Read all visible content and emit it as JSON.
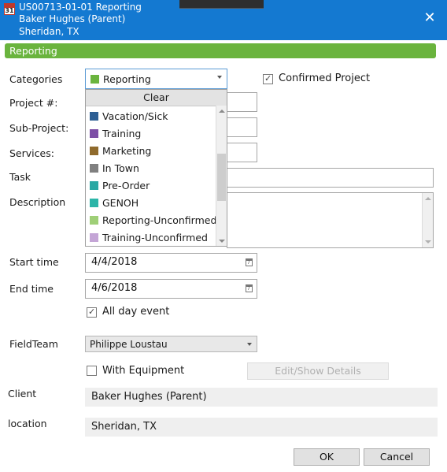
{
  "window": {
    "title_line1": "US00713-01-01 Reporting",
    "title_line2": "Baker Hughes (Parent)",
    "title_line3": "Sheridan, TX",
    "app_icon_text": "31",
    "close_glyph": "✕"
  },
  "banner": {
    "text": "Reporting",
    "color": "#6ab43e"
  },
  "form": {
    "categories_label": "Categories",
    "categories_value": "Reporting",
    "categories_color": "#6ab43e",
    "confirmed_label": "Confirmed Project",
    "confirmed_checked": true,
    "project_label": "Project #:",
    "subproject_label": "Sub-Project:",
    "services_label": "Services:",
    "task_label": "Task",
    "description_label": "Description",
    "start_label": "Start time",
    "start_value": "4/4/2018",
    "end_label": "End time",
    "end_value": "4/6/2018",
    "allday_label": "All day event",
    "allday_checked": true,
    "fieldteam_label": "FieldTeam",
    "fieldteam_value": "Philippe Loustau",
    "equipment_label": "With Equipment",
    "equipment_checked": false,
    "edit_details_label": "Edit/Show Details",
    "client_label": "Client",
    "client_value": "Baker Hughes (Parent)",
    "location_label": "location",
    "location_value": "Sheridan, TX",
    "ok_label": "OK",
    "cancel_label": "Cancel"
  },
  "dropdown": {
    "clear_label": "Clear",
    "items": [
      {
        "label": "Vacation/Sick",
        "color": "#2e5f94"
      },
      {
        "label": "Training",
        "color": "#7d4fa6"
      },
      {
        "label": "Marketing",
        "color": "#8f6a2c"
      },
      {
        "label": "In Town",
        "color": "#808080"
      },
      {
        "label": "Pre-Order",
        "color": "#2aa8a3"
      },
      {
        "label": "GENOH",
        "color": "#2cb5a8"
      },
      {
        "label": "Reporting-Unconfirmed",
        "color": "#9fcf77"
      },
      {
        "label": "Training-Unconfirmed",
        "color": "#c4a5d6"
      }
    ],
    "scroll_position": 0.45
  }
}
